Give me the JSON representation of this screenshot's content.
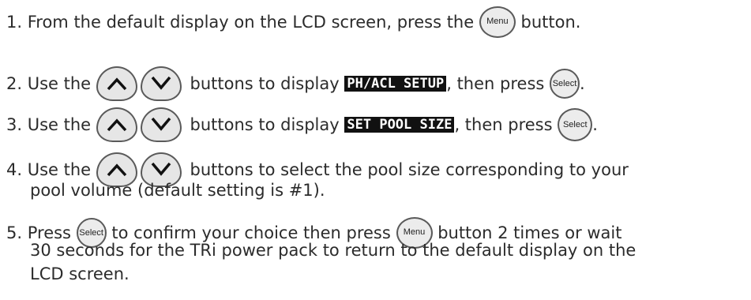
{
  "steps": [
    {
      "num": "1.",
      "a": "From the default display on the LCD screen, press the",
      "btn": "Menu",
      "b": "button."
    },
    {
      "num": "2.",
      "a": "Use the",
      "b": "buttons to display",
      "lcd": "PH/ACL SETUP",
      "c": ", then press",
      "btn": "Select",
      "d": "."
    },
    {
      "num": "3.",
      "a": "Use the",
      "b": "buttons to display",
      "lcd": "SET POOL SIZE",
      "c": ", then press",
      "btn": "Select",
      "d": "."
    },
    {
      "num": "4.",
      "a": "Use the",
      "b": "buttons to select the pool size corresponding to your",
      "cont": "pool volume (default setting is #1)."
    },
    {
      "num": "5.",
      "a": "Press",
      "btn1": "Select",
      "b": "to confirm your choice then press",
      "btn2": "Menu",
      "c": "button 2 times or wait",
      "cont1": "30 seconds for the TRi power pack to return to the default display on the",
      "cont2": "LCD screen."
    }
  ]
}
